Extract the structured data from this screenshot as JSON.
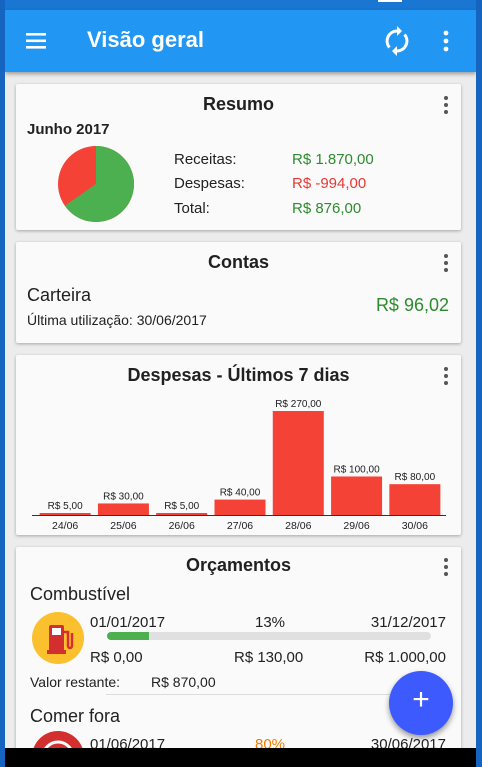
{
  "appbar": {
    "title": "Visão geral",
    "menu_icon": "menu-icon",
    "sync_icon": "sync-icon",
    "more_icon": "more-vert-icon"
  },
  "summary": {
    "title": "Resumo",
    "month": "Junho 2017",
    "income_label": "Receitas:",
    "income_value": "R$ 1.870,00",
    "expenses_label": "Despesas:",
    "expenses_value": "R$ -994,00",
    "total_label": "Total:",
    "total_value": "R$ 876,00",
    "pie": {
      "income": 1870,
      "expenses": 994,
      "income_color": "#4caf50",
      "expense_color": "#f44336"
    }
  },
  "accounts": {
    "title": "Contas",
    "name": "Carteira",
    "last_used": "Última utilização: 30/06/2017",
    "balance": "R$ 96,02"
  },
  "expenses7": {
    "title": "Despesas - Últimos 7 dias"
  },
  "chart_data": {
    "type": "bar",
    "categories": [
      "24/06",
      "25/06",
      "26/06",
      "27/06",
      "28/06",
      "29/06",
      "30/06"
    ],
    "values": [
      5,
      30,
      5,
      40,
      270,
      100,
      80
    ],
    "labels": [
      "R$ 5,00",
      "R$ 30,00",
      "R$ 5,00",
      "R$ 40,00",
      "R$ 270,00",
      "R$ 100,00",
      "R$ 80,00"
    ],
    "title": "Despesas - Últimos 7 dias",
    "xlabel": "",
    "ylabel": "",
    "ylim": [
      0,
      270
    ],
    "color": "#f44336"
  },
  "budgets": {
    "title": "Orçamentos",
    "items": [
      {
        "name": "Combustível",
        "start": "01/01/2017",
        "percent": "13%",
        "percent_value": 0.13,
        "end": "31/12/2017",
        "spent": "R$ 0,00",
        "current": "R$ 130,00",
        "limit": "R$ 1.000,00",
        "remaining_label": "Valor restante:",
        "remaining_value": "R$ 870,00",
        "icon": "fuel-pump-icon"
      },
      {
        "name": "Comer fora",
        "start": "01/06/2017",
        "percent": "80%",
        "end": "30/06/2017",
        "icon": "restaurant-icon"
      }
    ]
  },
  "fab": {
    "label": "+"
  }
}
